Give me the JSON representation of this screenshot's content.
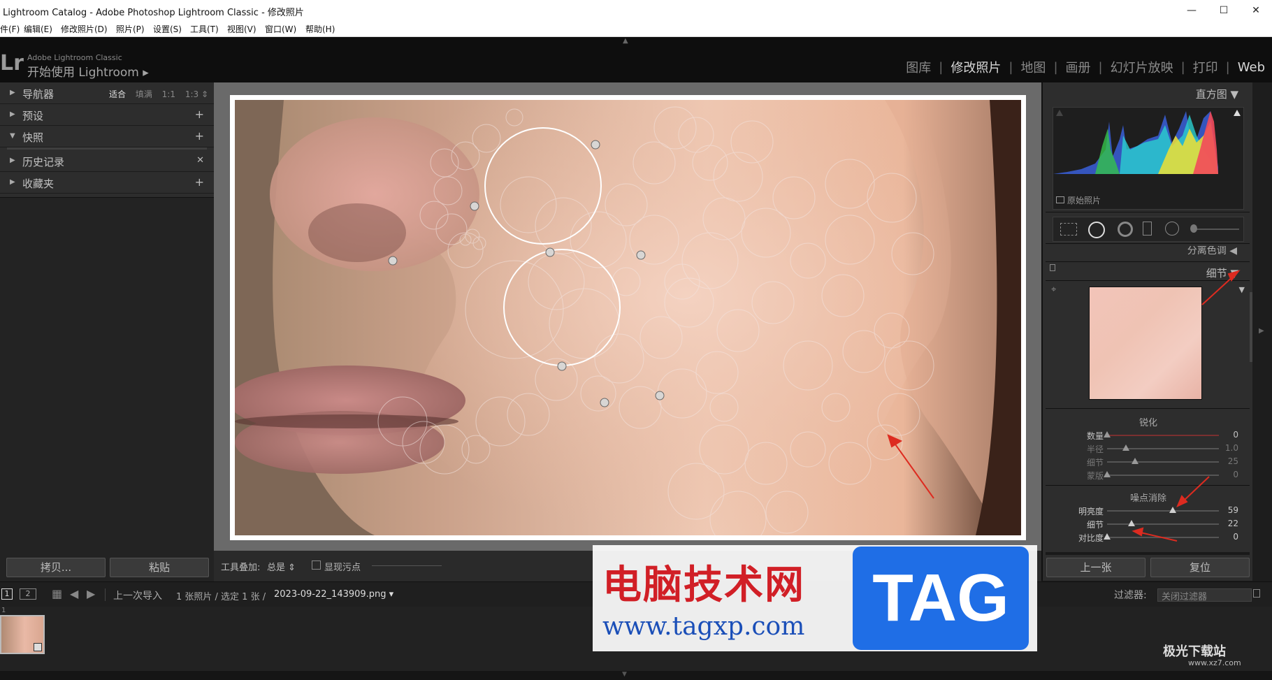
{
  "window": {
    "title": "Lightroom Catalog - Adobe Photoshop Lightroom Classic - 修改照片",
    "minimize": "—",
    "maximize": "☐",
    "close": "✕"
  },
  "menu": [
    "件(F)",
    "编辑(E)",
    "修改照片(D)",
    "照片(P)",
    "设置(S)",
    "工具(T)",
    "视图(V)",
    "窗口(W)",
    "帮助(H)"
  ],
  "brand": {
    "logo": "Lr",
    "small": "Adobe Lightroom Classic",
    "big": "开始使用 Lightroom ▸"
  },
  "modules": [
    "图库",
    "修改照片",
    "地图",
    "画册",
    "幻灯片放映",
    "打印",
    "Web"
  ],
  "left_panel": {
    "navigator": {
      "label": "导航器",
      "zoom": [
        "适合",
        "填满",
        "1:1",
        "1:3 ⇕"
      ]
    },
    "presets": {
      "label": "预设",
      "action": "+"
    },
    "snapshots": {
      "label": "快照",
      "action": "+"
    },
    "history": {
      "label": "历史记录",
      "action": "✕"
    },
    "collections": {
      "label": "收藏夹",
      "action": "+"
    },
    "copy_button": "拷贝...",
    "paste_button": "粘贴"
  },
  "toolbar": {
    "overlay_label": "工具叠加:",
    "overlay_value": "总是 ⇕",
    "show_spots_label": "显现污点"
  },
  "right_panel": {
    "histogram_title": "直方图 ▼",
    "original_photo": "原始照片",
    "split_toning": "分离色调 ◀",
    "detail_title": "细节 ▼",
    "sharpening": {
      "title": "锐化",
      "rows": [
        {
          "label": "数量",
          "value": "0",
          "pos": 0
        },
        {
          "label": "半径",
          "value": "1.0",
          "pos": 0.17
        },
        {
          "label": "细节",
          "value": "25",
          "pos": 0.25
        },
        {
          "label": "蒙版",
          "value": "0",
          "pos": 0
        }
      ]
    },
    "noise_reduction": {
      "title": "噪点消除",
      "rows": [
        {
          "label": "明亮度",
          "value": "59",
          "pos": 0.59
        },
        {
          "label": "细节",
          "value": "22",
          "pos": 0.22
        },
        {
          "label": "对比度",
          "value": "0",
          "pos": 0
        }
      ]
    },
    "prev_button": "上一张",
    "reset_button": "复位"
  },
  "filmstrip": {
    "page1": "1",
    "page2": "2",
    "source": "上一次导入",
    "info": "1 张照片 / 选定 1 张 /",
    "filename": "2023-09-22_143909.png ▾",
    "filter_label": "过滤器:",
    "filter_value": "关闭过滤器",
    "thumb_index": "1"
  },
  "watermark": {
    "text_cn": "电脑技术网",
    "url": "www.tagxp.com",
    "tag": "TAG",
    "corner": "极光下载站",
    "corner_url": "www.xz7.com"
  }
}
